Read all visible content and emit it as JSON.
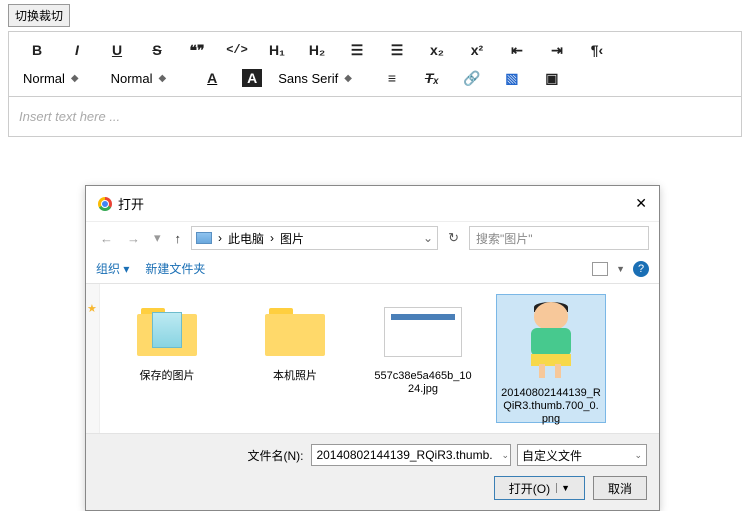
{
  "top_button": "切换裁切",
  "toolbar": {
    "bold": "B",
    "italic": "I",
    "underline": "U",
    "strike": "S",
    "quote": "❝❞",
    "code": "</>",
    "h1": "H₁",
    "h2": "H₂",
    "olist": "≡",
    "ulist": "≡",
    "sub": "x₂",
    "sup": "x²",
    "indent_dec": "⇤",
    "indent_inc": "⇥",
    "rtl": "¶",
    "normal1": "Normal",
    "normal2": "Normal",
    "fontcolor": "A",
    "bgcolor": "A",
    "font": "Sans Serif",
    "align": "≡",
    "clear": "Tₓ",
    "link": "🔗",
    "image": "▣",
    "video": "▣"
  },
  "editor": {
    "placeholder": "Insert text here ..."
  },
  "dialog": {
    "title": "打开",
    "path": {
      "root": "此电脑",
      "folder": "图片",
      "sep": "›"
    },
    "search_placeholder": "搜索\"图片\"",
    "tools": {
      "organize": "组织 ▾",
      "newfolder": "新建文件夹"
    },
    "files": [
      {
        "name": "保存的图片",
        "type": "folder"
      },
      {
        "name": "本机照片",
        "type": "folder"
      },
      {
        "name": "557c38e5a465b_1024.jpg",
        "type": "image"
      },
      {
        "name": "20140802144139_RQiR3.thumb.700_0.png",
        "type": "cartoon",
        "selected": true
      }
    ],
    "filename_label": "文件名(N):",
    "filename_value": "20140802144139_RQiR3.thumb.",
    "filter": "自定义文件",
    "open_btn": "打开(O)",
    "cancel_btn": "取消"
  }
}
